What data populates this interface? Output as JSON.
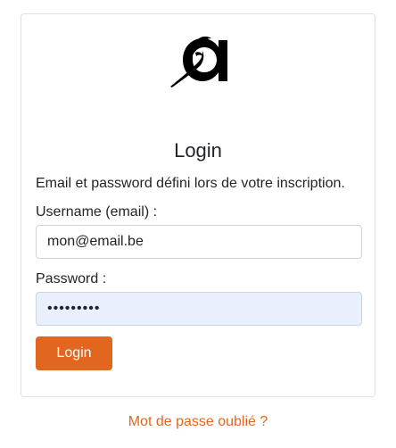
{
  "logo": {
    "icon": "brand-logo-icon",
    "color": "#000000"
  },
  "login": {
    "title": "Login",
    "description": "Email et password défini lors de votre inscription.",
    "username_label": "Username (email) :",
    "username_value": "mon@email.be",
    "password_label": "Password :",
    "password_value": "•••••••••",
    "submit_label": "Login",
    "forgot_link": "Mot de passe oublié ?"
  },
  "colors": {
    "accent": "#e2661f",
    "autofill_background": "#e8f0fe",
    "border": "#dee2e6"
  }
}
